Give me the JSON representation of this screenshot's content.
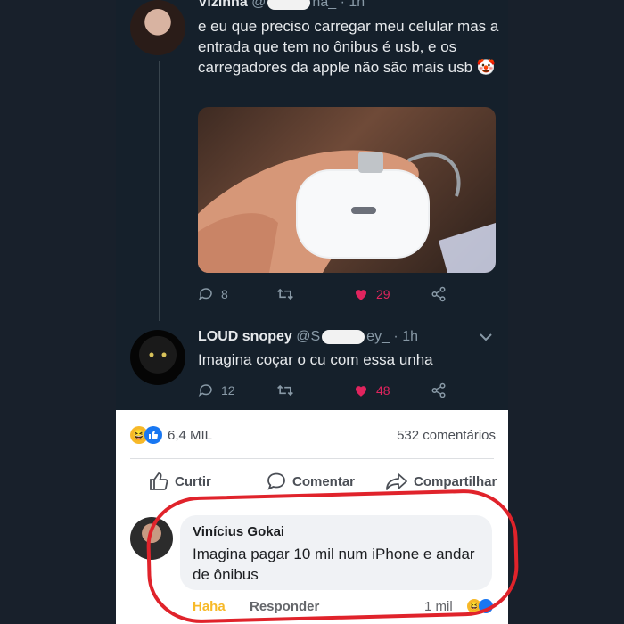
{
  "tweet1": {
    "name": "Vizinha",
    "handle_start": "@",
    "handle_end": "na_",
    "time": "· 1h",
    "text": "e eu que preciso carregar meu celular mas a entrada que tem no ônibus é usb, e os carregadores da apple não são mais usb 🤡",
    "replies": "8",
    "likes": "29"
  },
  "tweet2": {
    "name": "LOUD snopey",
    "handle_start": "@S",
    "handle_end": "ey_",
    "time": "· 1h",
    "text": "Imagina coçar o cu com essa unha",
    "replies": "12",
    "likes": "48"
  },
  "facebook": {
    "reactions_count": "6,4 MIL",
    "comments_count": "532 comentários",
    "like_label": "Curtir",
    "comment_label": "Comentar",
    "share_label": "Compartilhar",
    "comment": {
      "author": "Vinícius Gokai",
      "text": "Imagina pagar 10 mil num iPhone e andar de ônibus",
      "reply_label": "Responder",
      "like_label": "Haha",
      "time": "1 mil"
    }
  },
  "colors": {
    "twitter_bg": "#15202b",
    "heart": "#e0245e",
    "annotation_ring": "#e0232b",
    "fb_blue": "#1877f2"
  }
}
